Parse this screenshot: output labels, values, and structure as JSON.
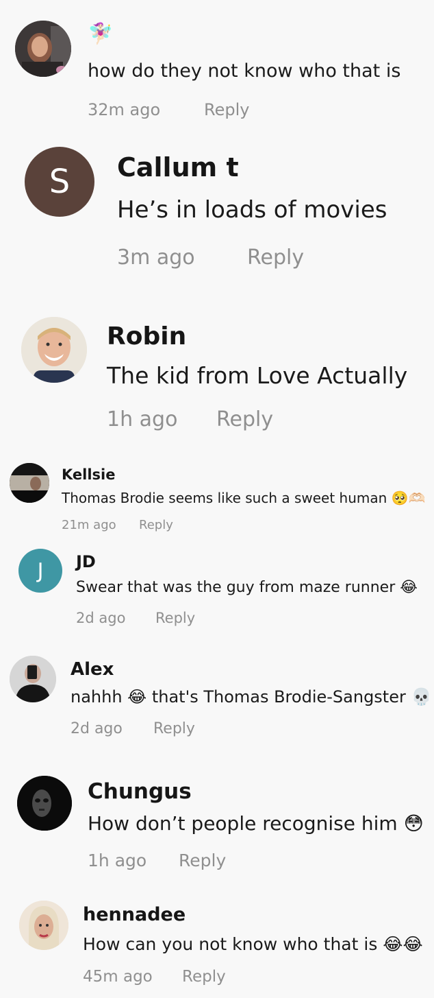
{
  "comments": [
    {
      "name": "🧚🏻‍♀️",
      "text": "how do they not know who that is",
      "time": "32m ago",
      "reply": "Reply"
    },
    {
      "name": "Callum t",
      "initial": "S",
      "avatar_color": "#5a423a",
      "text": "He’s in loads of movies",
      "time": "3m ago",
      "reply": "Reply"
    },
    {
      "name": "Robin",
      "text": "The kid from Love Actually",
      "time": "1h ago",
      "reply": "Reply"
    },
    {
      "name": "Kellsie",
      "text": "Thomas Brodie seems like such a sweet human 🥺🫶🏻",
      "time": "21m ago",
      "reply": "Reply"
    },
    {
      "name": "JD",
      "initial": "J",
      "avatar_color": "#3f97a4",
      "text": "Swear that was the guy from maze runner 😂",
      "time": "2d ago",
      "reply": "Reply"
    },
    {
      "name": "Alex",
      "text": "nahhh 😂 that's Thomas Brodie-Sangster 💀",
      "time": "2d ago",
      "reply": "Reply"
    },
    {
      "name": "Chungus",
      "text": "How don’t people recognise him 😳",
      "time": "1h ago",
      "reply": "Reply"
    },
    {
      "name": "hennadee",
      "text": "How can you not know who that is 😂😂",
      "time": "45m ago",
      "reply": "Reply"
    }
  ]
}
